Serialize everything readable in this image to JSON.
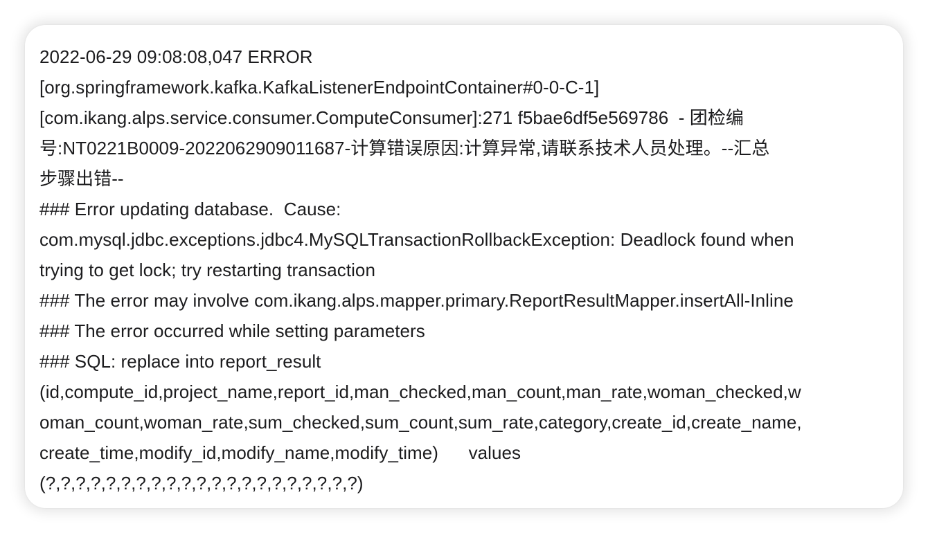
{
  "log": {
    "lines": [
      "2022-06-29 09:08:08,047 ERROR",
      "[org.springframework.kafka.KafkaListenerEndpointContainer#0-0-C-1]",
      "[com.ikang.alps.service.consumer.ComputeConsumer]:271 f5bae6df5e569786  - 团检编",
      "号:NT0221B0009-2022062909011687-计算错误原因:计算异常,请联系技术人员处理。--汇总",
      "步骤出错--",
      "### Error updating database.  Cause:",
      "com.mysql.jdbc.exceptions.jdbc4.MySQLTransactionRollbackException: Deadlock found when",
      "trying to get lock; try restarting transaction",
      "### The error may involve com.ikang.alps.mapper.primary.ReportResultMapper.insertAll-Inline",
      "### The error occurred while setting parameters",
      "### SQL: replace into report_result",
      "(id,compute_id,project_name,report_id,man_checked,man_count,man_rate,woman_checked,w",
      "oman_count,woman_rate,sum_checked,sum_count,sum_rate,category,create_id,create_name,",
      "create_time,modify_id,modify_name,modify_time)      values",
      "(?,?,?,?,?,?,?,?,?,?,?,?,?,?,?,?,?,?,?,?,?)"
    ]
  }
}
